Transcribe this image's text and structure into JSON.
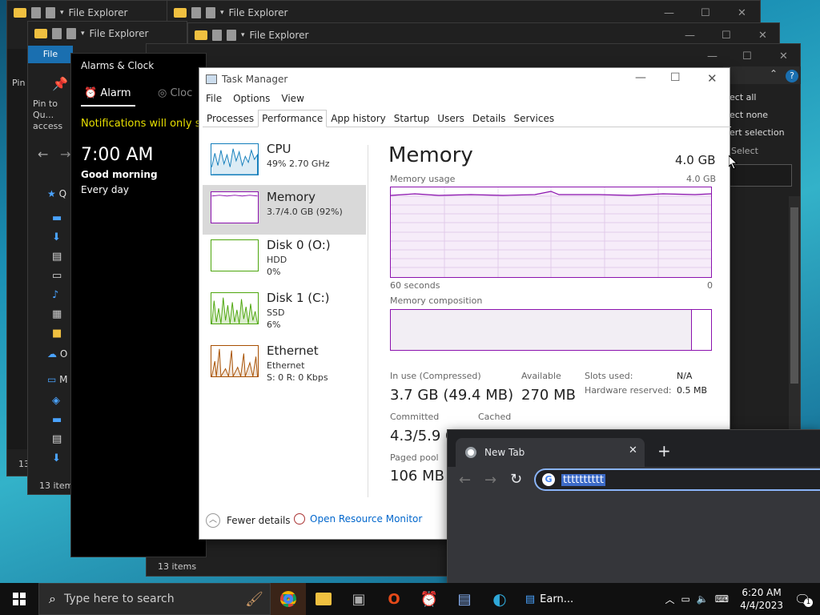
{
  "file_explorer": {
    "title": "File Explorer",
    "ribbon_file": "File",
    "pin_label": "Pin to Qu... access",
    "pin_short": "Pin",
    "menu_select_all": "ect all",
    "menu_select_none": "ect none",
    "menu_invert": "ert selection",
    "menu_select": "Select",
    "status_items": "13 items",
    "status_items_short": "13",
    "status_items_tb": "13 items",
    "nav_quick": "Q",
    "nav_onedrive": "O",
    "nav_mypc": "M"
  },
  "alarms": {
    "title": "Alarms & Clock",
    "tab_alarm": "Alarm",
    "tab_clock": "Cloc",
    "notification": "Notifications will only s",
    "alarm_time": "7:00 AM",
    "alarm_name": "Good morning",
    "alarm_repeat": "Every day"
  },
  "task_manager": {
    "title": "Task Manager",
    "menu": [
      "File",
      "Options",
      "View"
    ],
    "tabs": [
      "Processes",
      "Performance",
      "App history",
      "Startup",
      "Users",
      "Details",
      "Services"
    ],
    "active_tab": "Performance",
    "sidebar": [
      {
        "name": "CPU",
        "sub1": "49% 2.70 GHz",
        "sub2": "",
        "sub3": ""
      },
      {
        "name": "Memory",
        "sub1": "3.7/4.0 GB (92%)",
        "sub2": "",
        "sub3": ""
      },
      {
        "name": "Disk 0 (O:)",
        "sub1": "HDD",
        "sub2": "0%",
        "sub3": ""
      },
      {
        "name": "Disk 1 (C:)",
        "sub1": "SSD",
        "sub2": "6%",
        "sub3": ""
      },
      {
        "name": "Ethernet",
        "sub1": "Ethernet",
        "sub2": "S: 0 R: 0 Kbps",
        "sub3": ""
      }
    ],
    "memory": {
      "heading": "Memory",
      "total": "4.0 GB",
      "usage_label": "Memory usage",
      "usage_max": "4.0 GB",
      "time_left": "60 seconds",
      "time_right": "0",
      "composition_label": "Memory composition",
      "composition_in_use_fraction": 0.94,
      "in_use_label": "In use (Compressed)",
      "in_use_value": "3.7 GB (49.4 MB)",
      "available_label": "Available",
      "available_value": "270 MB",
      "slots_label": "Slots used:",
      "slots_value": "N/A",
      "hw_label": "Hardware reserved:",
      "hw_value": "0.5 MB",
      "committed_label": "Committed",
      "committed_value": "4.3/5.9 G",
      "cached_label": "Cached",
      "paged_label": "Paged pool",
      "paged_value": "106 MB"
    },
    "footer": {
      "fewer": "Fewer details",
      "resmon": "Open Resource Monitor"
    }
  },
  "chrome": {
    "tab_title": "New Tab",
    "omnibox_value": "tttttttttt"
  },
  "taskbar": {
    "search_placeholder": "Type here to search",
    "earn_label": "Earn...",
    "time": "6:20 AM",
    "date": "4/4/2023",
    "notif_count": "1"
  },
  "colors": {
    "memory_purple": "#8b12ae",
    "cpu_blue": "#117dbb",
    "disk_green": "#4da60c",
    "eth_orange": "#a74f01",
    "link_blue": "#0066cc"
  }
}
